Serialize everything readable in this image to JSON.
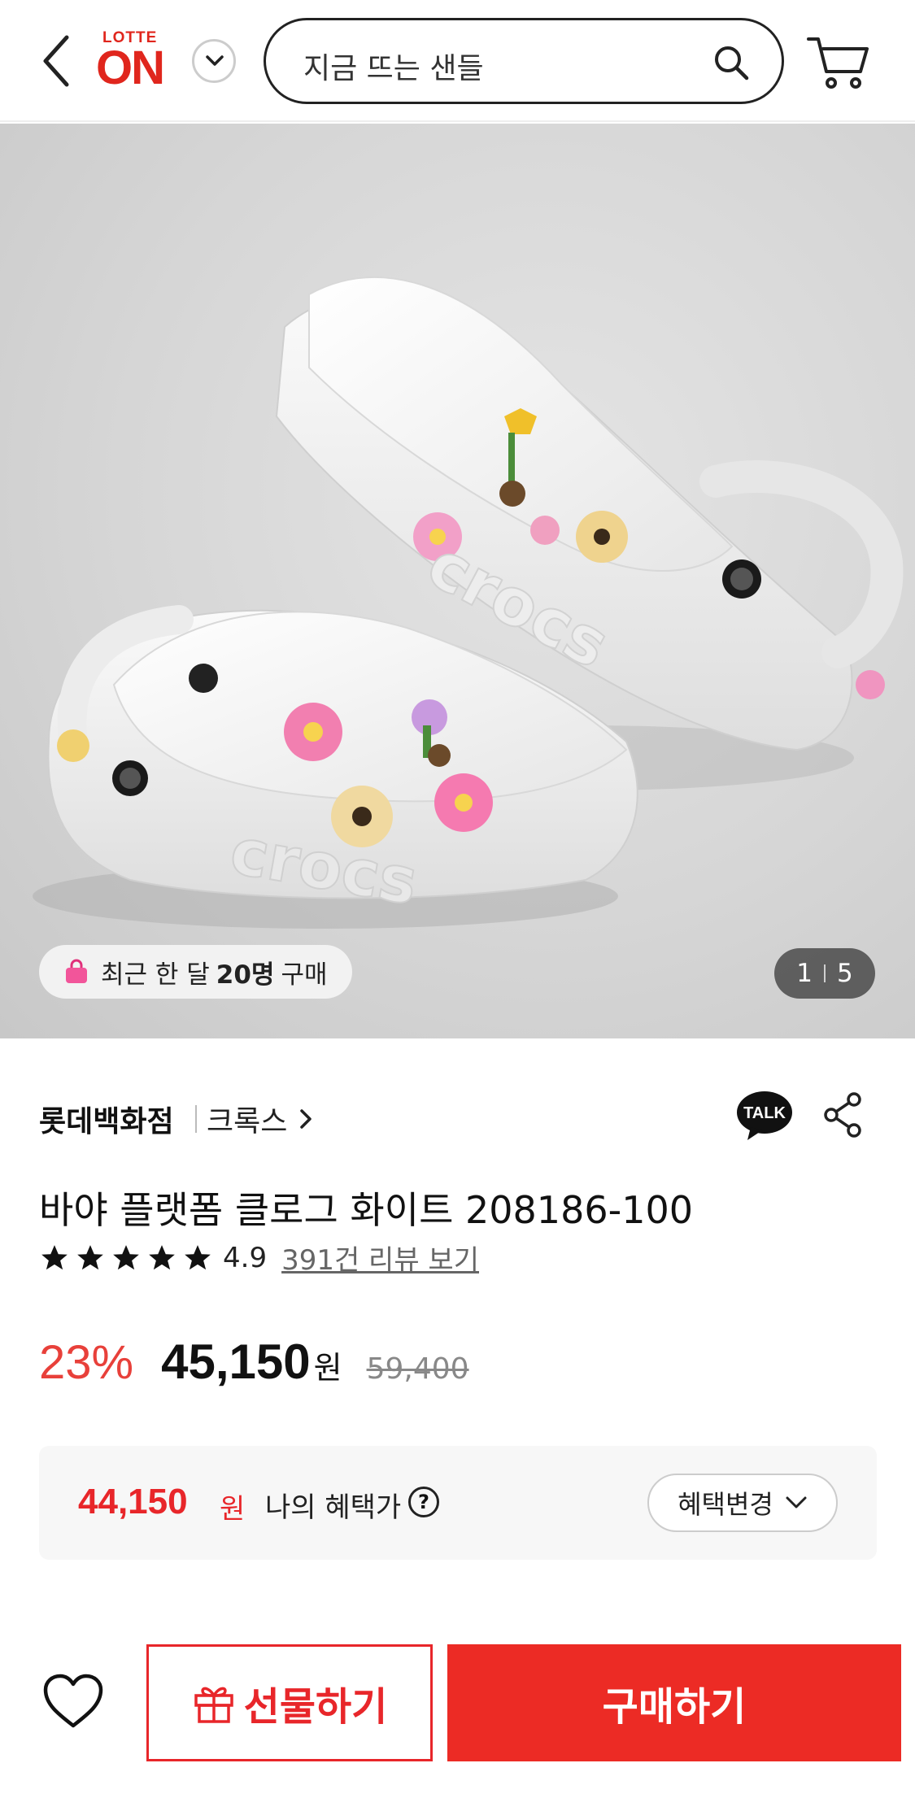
{
  "header": {
    "logo_top": "LOTTE",
    "logo_main": "ON",
    "search_placeholder": "지금 뜨는 샌들",
    "brand_color": "#e0261d"
  },
  "gallery": {
    "buyers_prefix": "최근 한 달",
    "buyers_count": "20명",
    "buyers_suffix": "구매",
    "current_page": "1",
    "total_pages": "5"
  },
  "product": {
    "store": "롯데백화점",
    "brand": "크록스",
    "talk_label": "TALK",
    "title": "바야 플랫폼 클로그 화이트 208186-100",
    "rating_value": "4.9",
    "rating_stars": 5,
    "review_link": "391건 리뷰 보기"
  },
  "pricing": {
    "discount": "23%",
    "price": "45,150",
    "currency": "원",
    "original_price": "59,400",
    "accent_color": "#e8403a"
  },
  "benefit": {
    "price": "44,150",
    "currency": "원",
    "label": "나의 혜택가",
    "help": "?",
    "change_label": "혜택변경"
  },
  "actions": {
    "gift_label": "선물하기",
    "buy_label": "구매하기",
    "buy_color": "#ec2b25"
  },
  "icons": [
    "back-icon",
    "chevron-down-icon",
    "search-icon",
    "cart-icon",
    "shopping-bag-icon",
    "kakao-talk-icon",
    "share-icon",
    "star-icon",
    "help-icon",
    "heart-icon",
    "gift-icon"
  ]
}
